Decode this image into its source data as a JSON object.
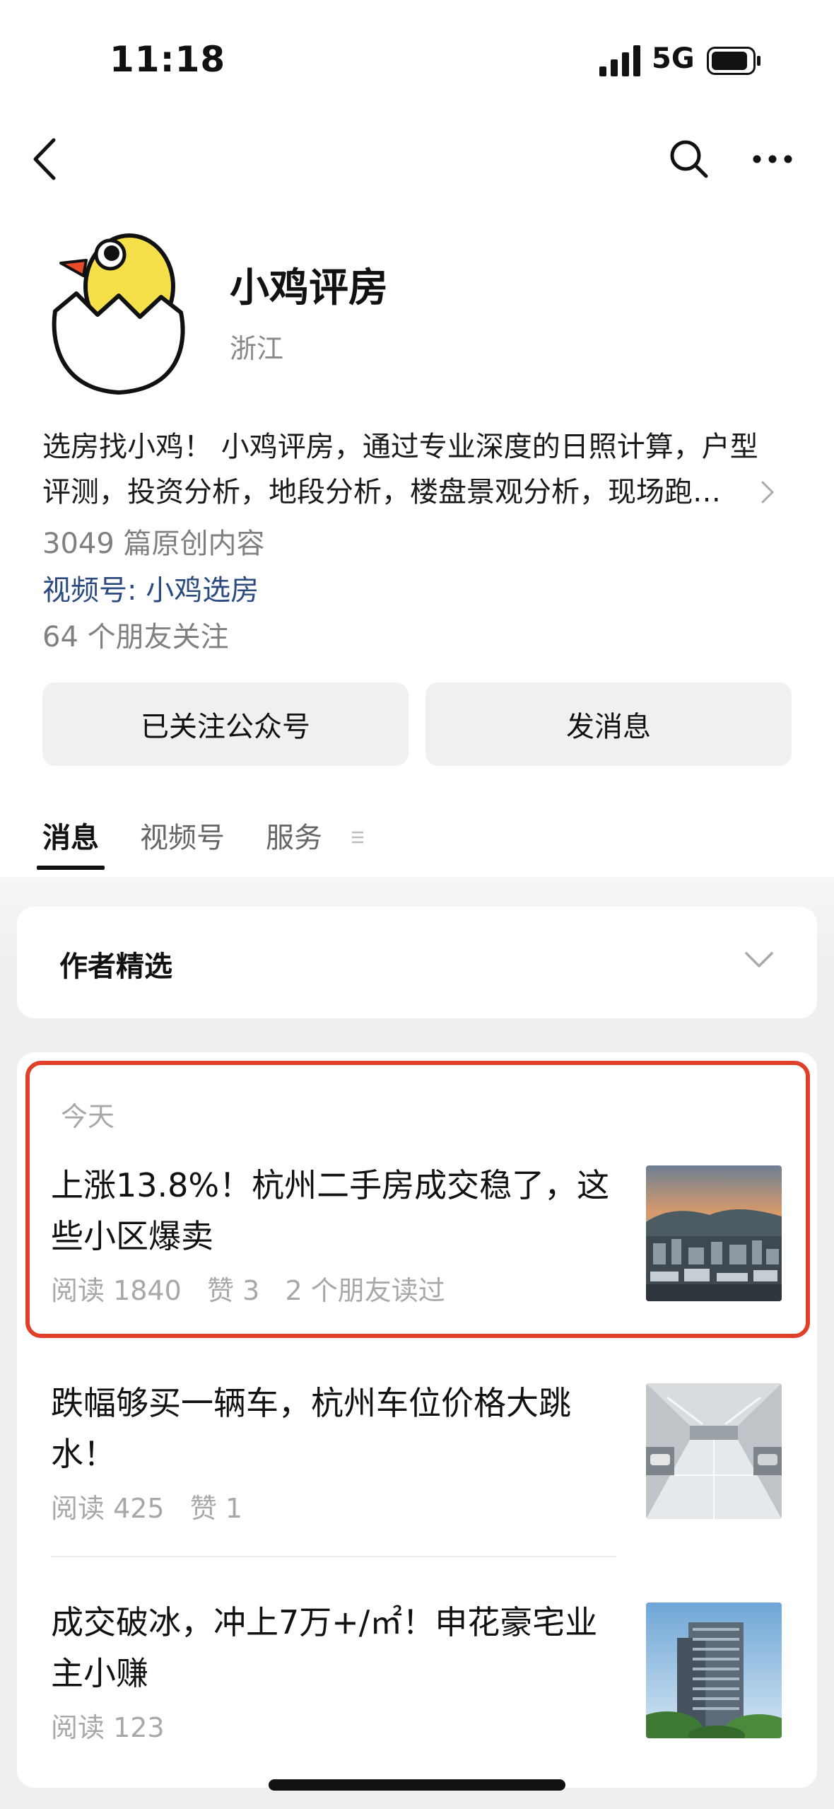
{
  "status_bar": {
    "time": "11:18",
    "network": "5G"
  },
  "nav": {
    "back_icon": "chevron-left-icon",
    "search_icon": "search-icon",
    "more_icon": "more-dots-icon"
  },
  "profile": {
    "name": "小鸡评房",
    "region": "浙江",
    "bio_line1": "选房找小鸡！ 小鸡评房，通过专业深度的日照计算，户型",
    "bio_line2": "评测，投资分析，地段分析，楼盘景观分析，现场跑…",
    "original_count": "3049 篇原创内容",
    "channel_link": "视频号: 小鸡选房",
    "friends_follow": "64 个朋友关注"
  },
  "actions": {
    "follow_label": "已关注公众号",
    "message_label": "发消息"
  },
  "tabs": [
    {
      "label": "消息"
    },
    {
      "label": "视频号"
    },
    {
      "label": "服务"
    }
  ],
  "author_pick": {
    "label": "作者精选"
  },
  "feed": {
    "date_label": "今天",
    "articles": [
      {
        "title": "上涨13.8%！杭州二手房成交稳了，这些小区爆卖",
        "meta": "阅读 1840   赞 3   2 个朋友读过",
        "thumb_icon": "city-skyline-photo"
      },
      {
        "title": "跌幅够买一辆车，杭州车位价格大跳水！",
        "meta": "阅读 425   赞 1",
        "thumb_icon": "parking-garage-photo"
      },
      {
        "title": "成交破冰，冲上7万+/㎡！申花豪宅业主小赚",
        "meta": "阅读 123",
        "thumb_icon": "tower-building-photo"
      }
    ]
  },
  "colors": {
    "highlight": "#e0402a",
    "link": "#2a4a80",
    "muted": "#a8a8a8"
  }
}
